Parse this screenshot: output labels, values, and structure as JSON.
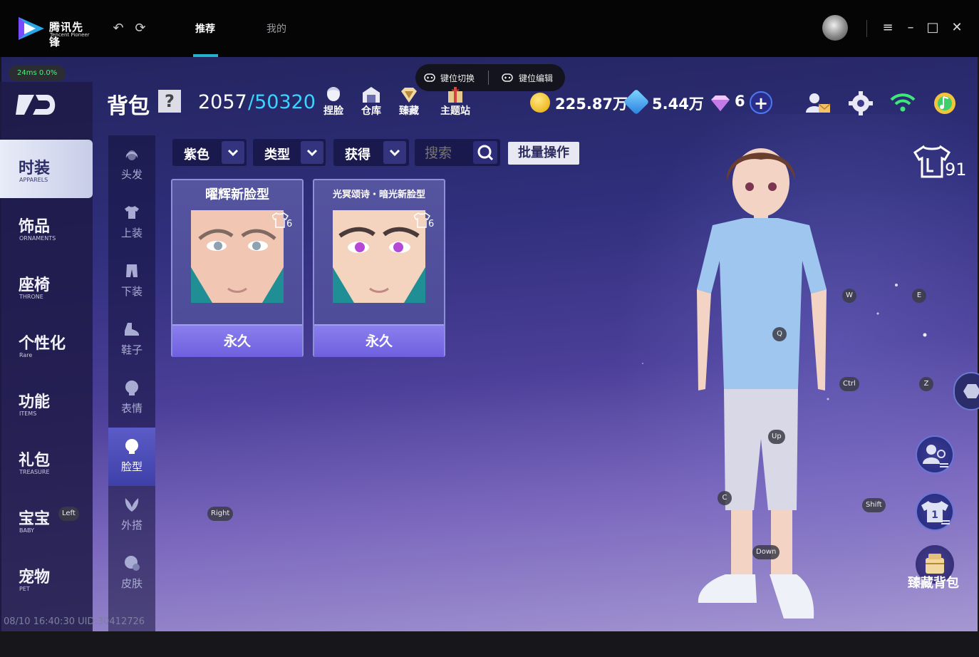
{
  "app": {
    "name_cn": "腾讯先锋",
    "name_en": "Tencent Pioneer"
  },
  "tabs": [
    {
      "label": "推荐",
      "active": true
    },
    {
      "label": "我的",
      "active": false
    }
  ],
  "status": {
    "ping": "24ms",
    "loss": "0.0%"
  },
  "keybar": {
    "switch_label": "键位切换",
    "edit_label": "键位编辑"
  },
  "header": {
    "title": "背包",
    "help": "?",
    "capacity_used": "2057",
    "capacity_max": "/50320",
    "buttons": [
      {
        "label": "捏脸",
        "icon": "face-icon"
      },
      {
        "label": "仓库",
        "icon": "warehouse-icon"
      },
      {
        "label": "臻藏",
        "icon": "collection-icon"
      },
      {
        "label": "主题站",
        "icon": "theme-station-icon"
      }
    ],
    "gold": "225.87万",
    "coupon": "5.44万",
    "diamond": "6"
  },
  "sidebar": {
    "items": [
      {
        "cn": "时装",
        "en": "APPARELS",
        "active": true
      },
      {
        "cn": "饰品",
        "en": "ORNAMENTS",
        "active": false
      },
      {
        "cn": "座椅",
        "en": "THRONE",
        "active": false
      },
      {
        "cn": "个性化",
        "en": "Rare",
        "active": false
      },
      {
        "cn": "功能",
        "en": "ITEMS",
        "active": false
      },
      {
        "cn": "礼包",
        "en": "TREASURE",
        "active": false
      },
      {
        "cn": "宝宝",
        "en": "BABY",
        "active": false
      },
      {
        "cn": "宠物",
        "en": "PET",
        "active": false
      }
    ]
  },
  "subnav": {
    "items": [
      {
        "label": "头发",
        "icon": "hair-icon",
        "active": false
      },
      {
        "label": "上装",
        "icon": "shirt-icon",
        "active": false
      },
      {
        "label": "下装",
        "icon": "pants-icon",
        "active": false
      },
      {
        "label": "鞋子",
        "icon": "shoe-icon",
        "active": false
      },
      {
        "label": "表情",
        "icon": "expression-icon",
        "active": false
      },
      {
        "label": "脸型",
        "icon": "face-shape-icon",
        "active": true
      },
      {
        "label": "外搭",
        "icon": "wings-icon",
        "active": false
      },
      {
        "label": "皮肤",
        "icon": "skin-icon",
        "active": false
      }
    ]
  },
  "filters": {
    "color": "紫色",
    "type": "类型",
    "source": "获得",
    "search_placeholder": "搜索",
    "batch": "批量操作"
  },
  "cards": [
    {
      "title": "曜辉新脸型",
      "badge": "6",
      "duration": "永久",
      "eye_color": "#8fa2b4"
    },
    {
      "title": "光冥颂诗・暗光新脸型",
      "badge": "6",
      "duration": "永久",
      "eye_color": "#b648d8"
    }
  ],
  "keys": {
    "W": "W",
    "E": "E",
    "Q": "Q",
    "Ctrl": "Ctrl",
    "Z": "Z",
    "Up": "Up",
    "C": "C",
    "Shift": "Shift",
    "Down": "Down",
    "Left": "Left",
    "Right": "Right"
  },
  "wardrobe_count": "91",
  "treasure_bag": "臻藏背包",
  "footer": {
    "timestamp": "08/10 16:40:30 UID:30412726"
  },
  "colors": {
    "accent": "#20b3c9",
    "capacity_max": "#3ed3ff",
    "ping": "#4ef07a"
  }
}
